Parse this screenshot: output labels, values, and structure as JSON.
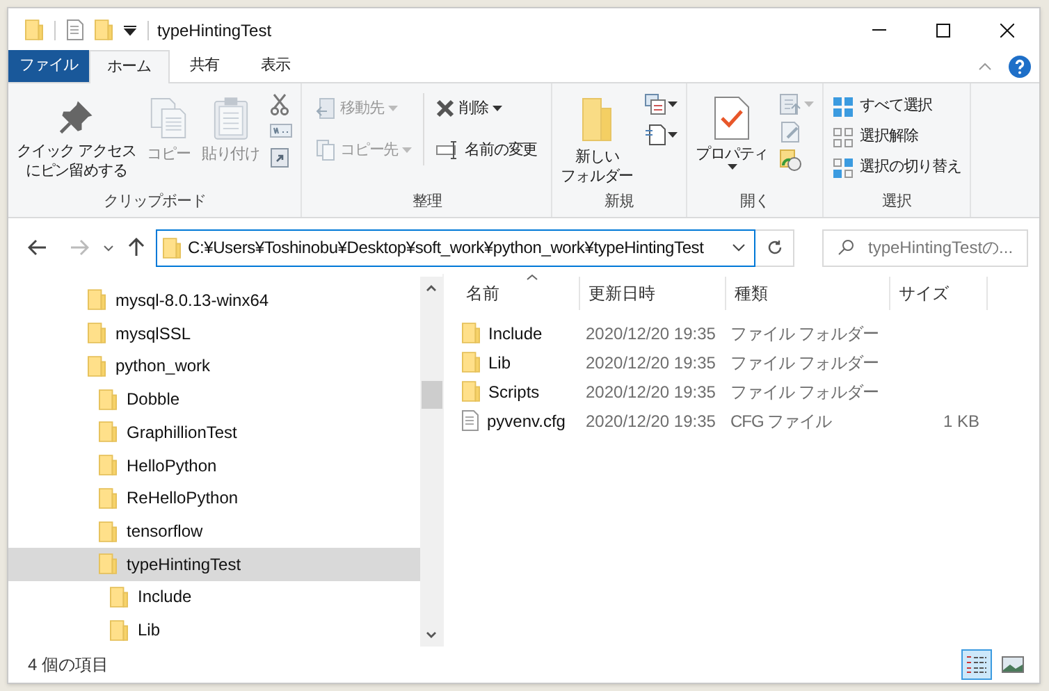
{
  "window": {
    "title": "typeHintingTest"
  },
  "tabs": [
    {
      "label": "ファイル",
      "kind": "file",
      "selected": false
    },
    {
      "label": "ホーム",
      "kind": "tab",
      "selected": true
    },
    {
      "label": "共有",
      "kind": "tab",
      "selected": false
    },
    {
      "label": "表示",
      "kind": "tab",
      "selected": false
    }
  ],
  "ribbon": {
    "groups": [
      {
        "label": "クリップボード",
        "items": [
          {
            "kind": "pin",
            "lines": [
              "クイック アクセス",
              "にピン留めする"
            ],
            "disabled": false
          },
          {
            "kind": "copy",
            "lines": [
              "コピー"
            ],
            "disabled": true
          },
          {
            "kind": "paste",
            "lines": [
              "貼り付け"
            ],
            "disabled": true
          },
          {
            "kind": "clipicons"
          }
        ]
      },
      {
        "label": "整理",
        "items": [
          {
            "kind": "organize",
            "columns": [
              [
                {
                  "kind": "move",
                  "label": "移動先",
                  "dropdown": true,
                  "disabled": true
                },
                {
                  "kind": "copyto",
                  "label": "コピー先",
                  "dropdown": true,
                  "disabled": true
                }
              ],
              [
                {
                  "kind": "delete",
                  "label": "削除",
                  "dropdown": true,
                  "disabled": false
                },
                {
                  "kind": "rename",
                  "label": "名前の変更",
                  "dropdown": false,
                  "disabled": false
                }
              ]
            ]
          }
        ]
      },
      {
        "label": "新規",
        "items": [
          {
            "kind": "newfolder",
            "lines": [
              "新しい",
              "フォルダー"
            ],
            "disabled": false
          },
          {
            "kind": "newicons"
          }
        ]
      },
      {
        "label": "開く",
        "items": [
          {
            "kind": "properties",
            "lines": [
              "プロパティ"
            ],
            "disabled": false
          },
          {
            "kind": "openicons"
          }
        ]
      },
      {
        "label": "選択",
        "items": [
          {
            "kind": "select",
            "rows": [
              {
                "kind": "all",
                "label": "すべて選択"
              },
              {
                "kind": "none",
                "label": "選択解除"
              },
              {
                "kind": "invert",
                "label": "選択の切り替え"
              }
            ]
          }
        ]
      }
    ]
  },
  "address": {
    "path": "C:¥Users¥Toshinobu¥Desktop¥soft_work¥python_work¥typeHintingTest"
  },
  "search": {
    "placeholder": "typeHintingTestの..."
  },
  "tree": [
    {
      "label": "mysql-8.0.13-winx64",
      "selected": false
    },
    {
      "label": "mysqlSSL",
      "selected": false
    },
    {
      "label": "python_work",
      "selected": false,
      "children": [
        {
          "label": "Dobble",
          "selected": false
        },
        {
          "label": "GraphillionTest",
          "selected": false
        },
        {
          "label": "HelloPython",
          "selected": false
        },
        {
          "label": "ReHelloPython",
          "selected": false
        },
        {
          "label": "tensorflow",
          "selected": false
        },
        {
          "label": "typeHintingTest",
          "selected": true,
          "children": [
            {
              "label": "Include",
              "selected": false
            },
            {
              "label": "Lib",
              "selected": false
            }
          ]
        }
      ]
    }
  ],
  "table": {
    "columns": [
      "名前",
      "更新日時",
      "種類",
      "サイズ"
    ],
    "rows": [
      {
        "kind": "folder",
        "name": "Include",
        "modified": "2020/12/20 19:35",
        "type": "ファイル フォルダー"
      },
      {
        "kind": "folder",
        "name": "Lib",
        "modified": "2020/12/20 19:35",
        "type": "ファイル フォルダー"
      },
      {
        "kind": "folder",
        "name": "Scripts",
        "modified": "2020/12/20 19:35",
        "type": "ファイル フォルダー"
      },
      {
        "kind": "file",
        "name": "pyvenv.cfg",
        "modified": "2020/12/20 19:35",
        "type": "CFG ファイル",
        "size": "1 KB"
      }
    ]
  },
  "status_bar": {
    "text": "4 個の項目",
    "views": [
      {
        "kind": "details",
        "selected": true
      },
      {
        "kind": "large",
        "selected": false
      }
    ]
  }
}
